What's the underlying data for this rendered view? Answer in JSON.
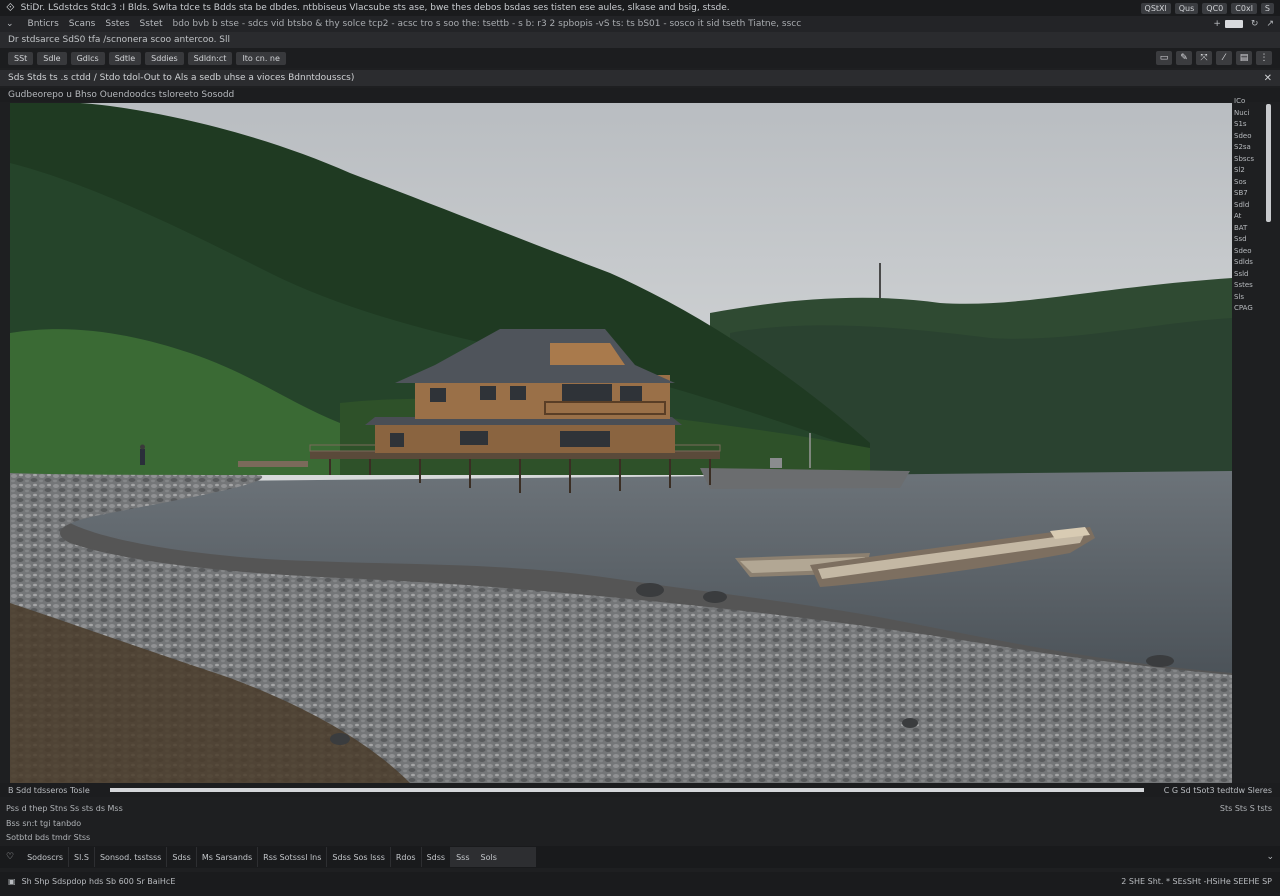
{
  "menubar": {
    "text": "StiDr. LSdstdcs  Stdc3 :I Blds.  Swlta tdce ts Bdds sta be dbdes.  ntbbiseus  Vlacsube sts ase, bwe thes debos  bsdas ses tisten ese aules, slkase and bsig, stsde.",
    "pills": [
      "QStXl",
      "Qus",
      "QC0",
      "C0xl",
      "S"
    ]
  },
  "toolbar2": {
    "items": [
      "Bnticrs",
      "Scans",
      "Sstes",
      "Sstet"
    ],
    "long_text": "bdo bvb  b stse  - sdcs  vid btsbo  & thy  solce tcp2  - acsc tro s soo  the: tsettb - s b: r3 2 spbopis  -vS ts: ts bS01 - sosco it sid tseth Tiatne, sscc"
  },
  "address": {
    "text": "Dr stdsarce  SdS0  tfa  /scnonera scoo antercoo. Sll"
  },
  "toolbar4": {
    "buttons": [
      "SSt",
      "Sdle",
      "Gdlcs",
      "Sdtle",
      "Sddies",
      "Sdldn:ct",
      "Ito cn. ne"
    ],
    "tools": [
      "copy-icon",
      "wrench-icon",
      "transform-icon",
      "pen-icon",
      "layer-icon",
      "more-icon"
    ]
  },
  "path_bar": {
    "text": "Sds Stds ts  .s ctdd  / Stdo tdol-Out to  Als a sedb uhse a vioces Bdnntdousscs)"
  },
  "caption_bar": {
    "text": "Gudbeorepo u  Bhso Ouendoodcs  tsloreeto Sosodd"
  },
  "side_panel": [
    "ICo",
    "Nuci",
    "S1s",
    "Sdeo",
    "S2sa",
    "Sbscs",
    "Sl2",
    "Sos",
    "SB7",
    "Sdld",
    "At",
    "BAT",
    "Ssd",
    "Sdeo",
    "Sdlds",
    "Ssld",
    "Sstes",
    "Sls",
    "CPAG"
  ],
  "status1": {
    "left": "B  Sdd tdsseros   Tosle",
    "right": "C  G Sd tSot3 tedtdw Sleres"
  },
  "info": {
    "line1": "Pss d  thep  Stns  Ss sts ds Mss",
    "line1_right": "Sts  Sts  S tsts",
    "line2": "Bss  sn:t tgi tanbdo",
    "line3": "Sotbtd   bds  tmdr  Stss"
  },
  "tabs": [
    "Sodoscrs",
    "Sl.S",
    "Sonsod. tsstsss",
    "Sdss",
    "Ms  Sarsands",
    "Rss Sotsssl lns",
    "Sdss  Sos  lsss",
    "Rdos",
    "Sdss",
    "Sss",
    "Sols"
  ],
  "footer": {
    "left": "Sh Shp  Sdspdop  hds  Sb 600 Sr BaiHcE",
    "right": "2 SHE  Sht.   *  SEsSHt  -HSiHe  SEEHE SP"
  },
  "colors": {
    "bg": "#1e1f21",
    "bar": "#2a2b2e",
    "text": "#b9bcc0"
  }
}
